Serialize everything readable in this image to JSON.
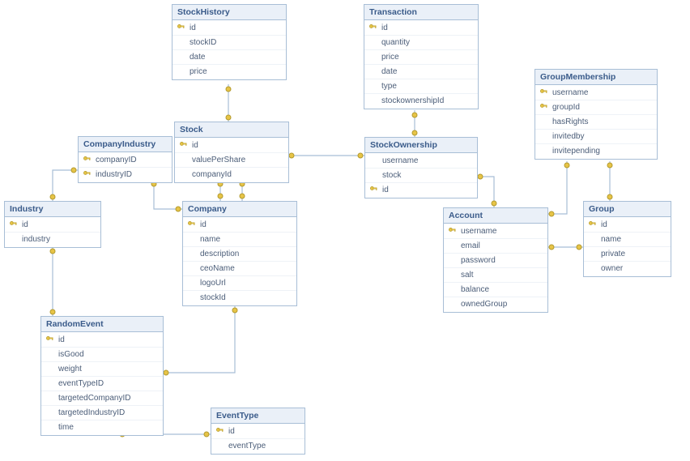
{
  "entities": {
    "StockHistory": {
      "title": "StockHistory",
      "fields": [
        {
          "name": "id",
          "key": true
        },
        {
          "name": "stockID",
          "key": false
        },
        {
          "name": "date",
          "key": false
        },
        {
          "name": "price",
          "key": false
        }
      ]
    },
    "Transaction": {
      "title": "Transaction",
      "fields": [
        {
          "name": "id",
          "key": true
        },
        {
          "name": "quantity",
          "key": false
        },
        {
          "name": "price",
          "key": false
        },
        {
          "name": "date",
          "key": false
        },
        {
          "name": "type",
          "key": false
        },
        {
          "name": "stockownershipId",
          "key": false
        }
      ]
    },
    "GroupMembership": {
      "title": "GroupMembership",
      "fields": [
        {
          "name": "username",
          "key": true
        },
        {
          "name": "groupId",
          "key": true
        },
        {
          "name": "hasRights",
          "key": false
        },
        {
          "name": "invitedby",
          "key": false
        },
        {
          "name": "invitepending",
          "key": false
        }
      ]
    },
    "Stock": {
      "title": "Stock",
      "fields": [
        {
          "name": "id",
          "key": true
        },
        {
          "name": "valuePerShare",
          "key": false
        },
        {
          "name": "companyId",
          "key": false
        }
      ]
    },
    "CompanyIndustry": {
      "title": "CompanyIndustry",
      "fields": [
        {
          "name": "companyID",
          "key": true
        },
        {
          "name": "industryID",
          "key": true
        }
      ]
    },
    "StockOwnership": {
      "title": "StockOwnership",
      "fields": [
        {
          "name": "username",
          "key": false
        },
        {
          "name": "stock",
          "key": false
        },
        {
          "name": "id",
          "key": true
        }
      ]
    },
    "Industry": {
      "title": "Industry",
      "fields": [
        {
          "name": "id",
          "key": true
        },
        {
          "name": "industry",
          "key": false
        }
      ]
    },
    "Company": {
      "title": "Company",
      "fields": [
        {
          "name": "id",
          "key": true
        },
        {
          "name": "name",
          "key": false
        },
        {
          "name": "description",
          "key": false
        },
        {
          "name": "ceoName",
          "key": false
        },
        {
          "name": "logoUrl",
          "key": false
        },
        {
          "name": "stockId",
          "key": false
        }
      ]
    },
    "Account": {
      "title": "Account",
      "fields": [
        {
          "name": "username",
          "key": true
        },
        {
          "name": "email",
          "key": false
        },
        {
          "name": "password",
          "key": false
        },
        {
          "name": "salt",
          "key": false
        },
        {
          "name": "balance",
          "key": false
        },
        {
          "name": "ownedGroup",
          "key": false
        }
      ]
    },
    "Group": {
      "title": "Group",
      "fields": [
        {
          "name": "id",
          "key": true
        },
        {
          "name": "name",
          "key": false
        },
        {
          "name": "private",
          "key": false
        },
        {
          "name": "owner",
          "key": false
        }
      ]
    },
    "RandomEvent": {
      "title": "RandomEvent",
      "fields": [
        {
          "name": "id",
          "key": true
        },
        {
          "name": "isGood",
          "key": false
        },
        {
          "name": "weight",
          "key": false
        },
        {
          "name": "eventTypeID",
          "key": false
        },
        {
          "name": "targetedCompanyID",
          "key": false
        },
        {
          "name": "targetedIndustryID",
          "key": false
        },
        {
          "name": "time",
          "key": false
        }
      ]
    },
    "EventType": {
      "title": "EventType",
      "fields": [
        {
          "name": "id",
          "key": true
        },
        {
          "name": "eventType",
          "key": false
        }
      ]
    }
  },
  "relationships": [
    {
      "from": "StockHistory",
      "to": "Stock"
    },
    {
      "from": "Transaction",
      "to": "StockOwnership"
    },
    {
      "from": "Stock",
      "to": "StockOwnership"
    },
    {
      "from": "Stock",
      "to": "Company"
    },
    {
      "from": "Stock",
      "to": "Company",
      "direction": "reverse"
    },
    {
      "from": "CompanyIndustry",
      "to": "Company"
    },
    {
      "from": "CompanyIndustry",
      "to": "Industry"
    },
    {
      "from": "Industry",
      "to": "RandomEvent"
    },
    {
      "from": "RandomEvent",
      "to": "Company"
    },
    {
      "from": "RandomEvent",
      "to": "EventType"
    },
    {
      "from": "StockOwnership",
      "to": "Account"
    },
    {
      "from": "Account",
      "to": "GroupMembership"
    },
    {
      "from": "Account",
      "to": "Group"
    },
    {
      "from": "Group",
      "to": "GroupMembership"
    }
  ]
}
